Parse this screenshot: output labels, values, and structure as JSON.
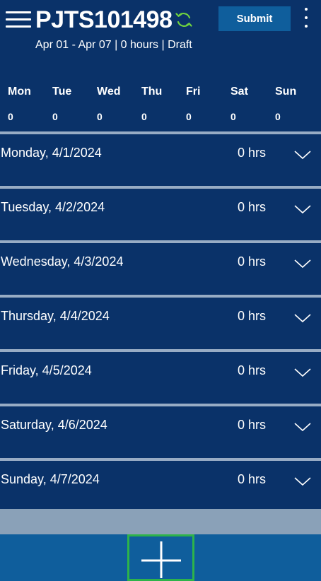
{
  "header": {
    "title": "PJTS101498",
    "subtitle": "Apr 01 - Apr 07 | 0 hours | Draft",
    "submit_label": "Submit"
  },
  "icons": {
    "menu": "hamburger-menu-icon",
    "refresh": "refresh-icon",
    "more": "more-vertical-icon",
    "expand": "chevron-down-icon",
    "add": "plus-icon"
  },
  "colors": {
    "background": "#0a3269",
    "separator": "#98acc4",
    "accent": "#0f5e9c",
    "refresh": "#6fd23f",
    "add_highlight": "#2db34a"
  },
  "week": [
    {
      "day": "Mon",
      "total": "0"
    },
    {
      "day": "Tue",
      "total": "0"
    },
    {
      "day": "Wed",
      "total": "0"
    },
    {
      "day": "Thu",
      "total": "0"
    },
    {
      "day": "Fri",
      "total": "0"
    },
    {
      "day": "Sat",
      "total": "0"
    },
    {
      "day": "Sun",
      "total": "0"
    }
  ],
  "days": [
    {
      "label": "Monday, 4/1/2024",
      "hours": "0 hrs"
    },
    {
      "label": "Tuesday, 4/2/2024",
      "hours": "0 hrs"
    },
    {
      "label": "Wednesday, 4/3/2024",
      "hours": "0 hrs"
    },
    {
      "label": "Thursday, 4/4/2024",
      "hours": "0 hrs"
    },
    {
      "label": "Friday, 4/5/2024",
      "hours": "0 hrs"
    },
    {
      "label": "Saturday, 4/6/2024",
      "hours": "0 hrs"
    },
    {
      "label": "Sunday, 4/7/2024",
      "hours": "0 hrs"
    }
  ]
}
